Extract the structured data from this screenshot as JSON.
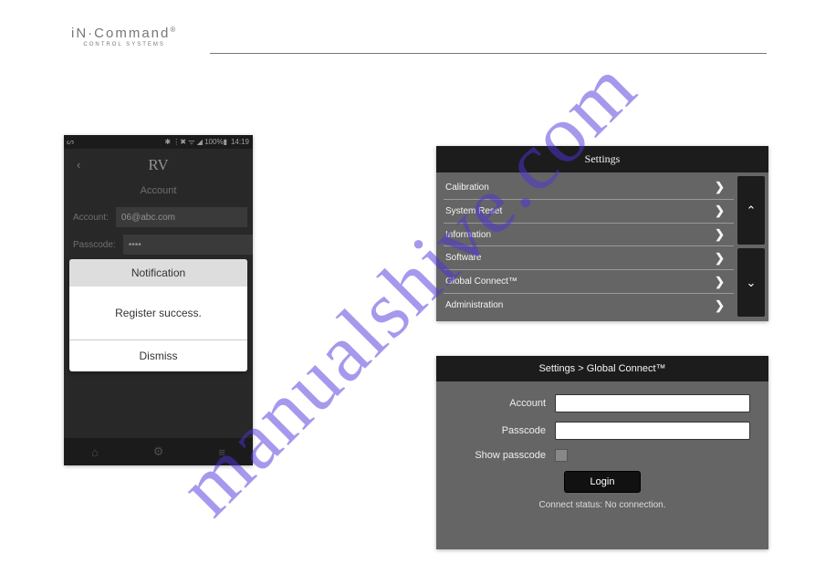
{
  "watermark": "manualshive.com",
  "logo": {
    "main": "iN·Command",
    "reg": "®",
    "sub": "CONTROL SYSTEMS"
  },
  "phone": {
    "statusbar": {
      "icons": "✱ ⋮✖ ᯤ ◢ 100%▮",
      "time": "14:19"
    },
    "back_glyph": "‹",
    "title": "RV",
    "subtitle": "Account",
    "account_label": "Account:",
    "account_value": "06@abc.com",
    "passcode_label": "Passcode:",
    "passcode_value": "••••",
    "dialog": {
      "title": "Notification",
      "body": "Register success.",
      "dismiss": "Dismiss"
    },
    "nav": {
      "home": "⌂",
      "gear": "⚙",
      "bars": "≡"
    }
  },
  "settings": {
    "title": "Settings",
    "items": [
      {
        "label": "Calibration"
      },
      {
        "label": "System Reset"
      },
      {
        "label": "Information"
      },
      {
        "label": "Software"
      },
      {
        "label": "Global Connect™"
      },
      {
        "label": "Administration"
      }
    ],
    "chevron": "❯",
    "up": "⌃",
    "down": "⌄"
  },
  "gc": {
    "breadcrumb": "Settings > Global Connect™",
    "account_label": "Account",
    "passcode_label": "Passcode",
    "show_label": "Show passcode",
    "login": "Login",
    "status": "Connect status: No connection."
  }
}
